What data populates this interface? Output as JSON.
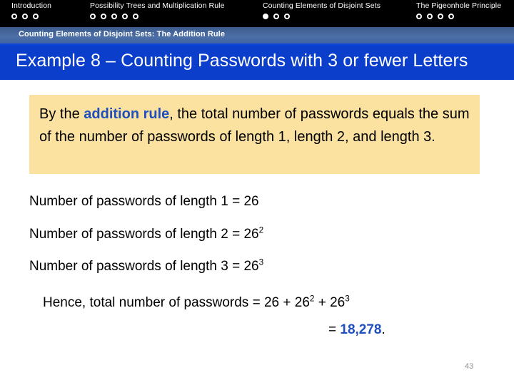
{
  "nav": {
    "sections": [
      {
        "label": "Introduction",
        "dots": [
          false,
          false,
          false
        ]
      },
      {
        "label": "Possibility Trees and Multiplication Rule",
        "dots": [
          false,
          false,
          false,
          false,
          false
        ]
      },
      {
        "label": "Counting Elements of Disjoint Sets",
        "dots": [
          true,
          false,
          false
        ]
      },
      {
        "label": "The Pigeonhole Principle",
        "dots": [
          false,
          false,
          false,
          false
        ]
      }
    ]
  },
  "subtitle": {
    "text": "Counting Elements of Disjoint Sets: The Addition Rule"
  },
  "title": {
    "text": "Example 8 – Counting Passwords with 3 or fewer Letters"
  },
  "callout": {
    "before": "By the ",
    "accent": "addition rule",
    "after": ", the total number of passwords equals the sum of the number of passwords of length 1, length 2, and length 3."
  },
  "statements": [
    {
      "text": "Number of passwords of length 1 = 26",
      "base": "",
      "exp": ""
    },
    {
      "text": "Number of passwords of length 2 = 26",
      "base": "26",
      "exp": "2"
    },
    {
      "text": "Number of passwords of length 3 = 26",
      "base": "26",
      "exp": "3"
    }
  ],
  "statement_lines": {
    "line1_main": "Number of passwords of length 1 = 26",
    "line2_main": "Number of passwords of length 2 = 26",
    "line2_exp": "2",
    "line3_main": "Number of passwords of length 3 = 26",
    "line3_exp": "3"
  },
  "conclusion": {
    "line1_part1": "Hence, total number of passwords = 26 + 26",
    "line1_exp1": "2",
    "line1_part2": " + 26",
    "line1_exp2": "3",
    "line2_prefix": "= ",
    "line2_value": "18,278",
    "line2_suffix": "."
  },
  "page": {
    "number": "43"
  },
  "colors": {
    "nav_background": "#000000",
    "subtitle_band": "#4c6fa6",
    "title_bar": "#0a3ecb",
    "callout_background": "#fce2a0",
    "accent_blue": "#1f4fbf",
    "page_number": "#8f8f8f"
  }
}
